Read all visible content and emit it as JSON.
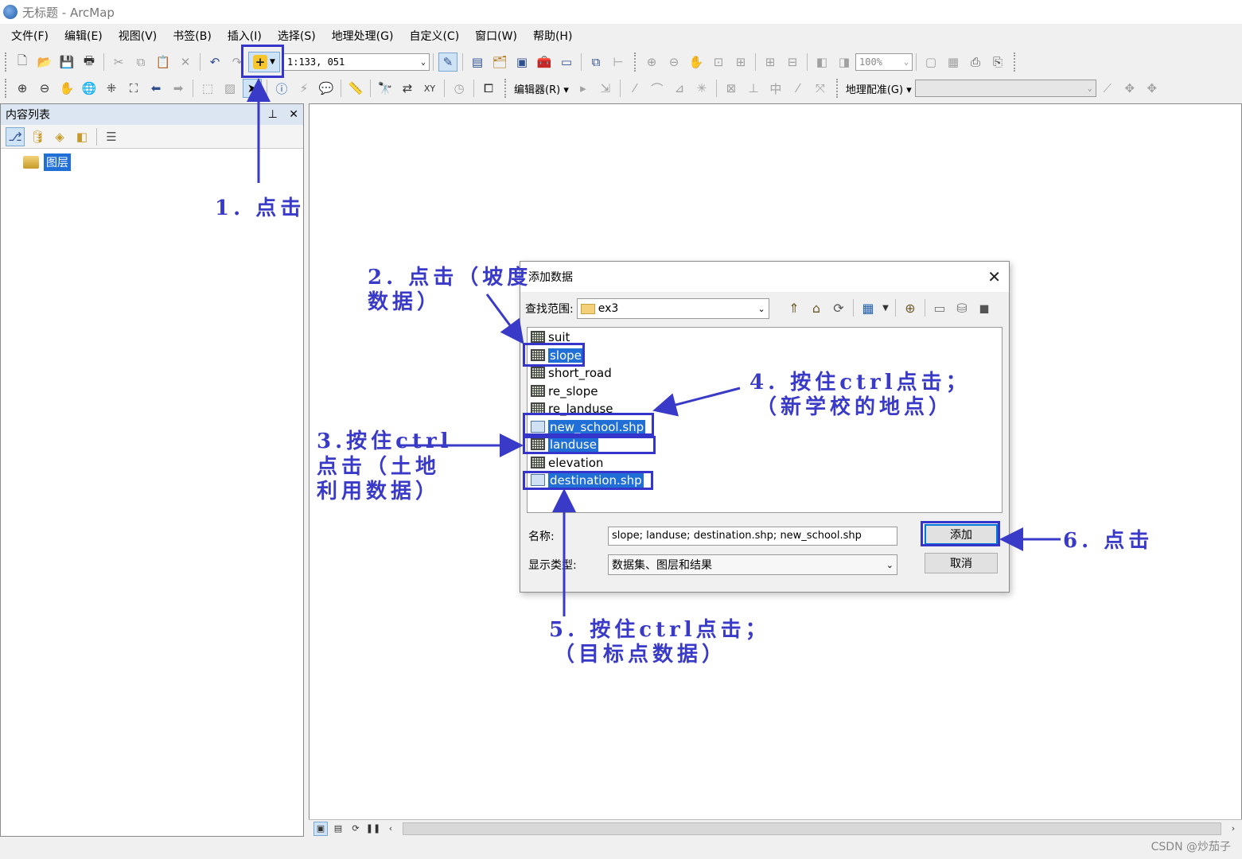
{
  "window": {
    "title": "无标题 - ArcMap"
  },
  "menubar": {
    "items": [
      "文件(F)",
      "编辑(E)",
      "视图(V)",
      "书签(B)",
      "插入(I)",
      "选择(S)",
      "地理处理(G)",
      "自定义(C)",
      "窗口(W)",
      "帮助(H)"
    ]
  },
  "toolbar": {
    "scale": "1:133, 051",
    "zoom_percent": "100%",
    "editor_label": "编辑器(R)",
    "georef_label": "地理配准(G)"
  },
  "toc": {
    "title": "内容列表",
    "root_layer": "图层"
  },
  "dialog": {
    "title": "添加数据",
    "look_in_label": "查找范围:",
    "look_in_value": "ex3",
    "files": [
      {
        "name": "suit",
        "selected": false
      },
      {
        "name": "slope",
        "selected": true
      },
      {
        "name": "short_road",
        "selected": false
      },
      {
        "name": "re_slope",
        "selected": false
      },
      {
        "name": "re_landuse",
        "selected": false
      },
      {
        "name": "new_school.shp",
        "selected": true
      },
      {
        "name": "landuse",
        "selected": true
      },
      {
        "name": "elevation",
        "selected": false
      },
      {
        "name": "destination.shp",
        "selected": true
      }
    ],
    "name_label": "名称:",
    "name_value": "slope; landuse; destination.shp; new_school.shp",
    "type_label": "显示类型:",
    "type_value": "数据集、图层和结果",
    "add_button": "添加",
    "cancel_button": "取消"
  },
  "annotations": {
    "step1": "1. 点击",
    "step2_line1": "2. 点击（坡度",
    "step2_line2": "数据）",
    "step3_line1": "3.按住ctrl",
    "step3_line2": "点击（土地",
    "step3_line3": "利用数据）",
    "step4_line1": "4. 按住ctrl点击；",
    "step4_line2": "（新学校的地点）",
    "step5_line1": "5. 按住ctrl点击；",
    "step5_line2": "（目标点数据）",
    "step6": "6. 点击",
    "color": "#3a3ac8"
  },
  "watermark": "CSDN @炒茄子"
}
